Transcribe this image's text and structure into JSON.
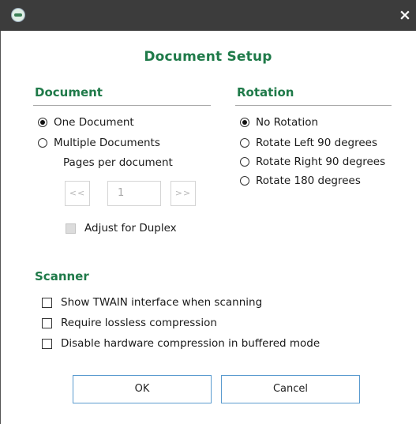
{
  "window": {
    "app_icon": "circle-app-logo",
    "close_label": "×"
  },
  "dialog": {
    "title": "Document Setup"
  },
  "document_group": {
    "header": "Document",
    "options": [
      {
        "label": "One Document",
        "selected": true
      },
      {
        "label": "Multiple Documents",
        "selected": false
      }
    ],
    "pages_per_document_label": "Pages per document",
    "prev_label": "<<",
    "page_value": "1",
    "next_label": ">>",
    "adjust_duplex_label": "Adjust for Duplex"
  },
  "rotation_group": {
    "header": "Rotation",
    "options": [
      {
        "label": "No Rotation",
        "selected": true
      },
      {
        "label": "Rotate Left 90 degrees",
        "selected": false
      },
      {
        "label": "Rotate Right 90 degrees",
        "selected": false
      },
      {
        "label": "Rotate 180 degrees",
        "selected": false
      }
    ]
  },
  "scanner_group": {
    "header": "Scanner",
    "options": [
      {
        "label": "Show TWAIN interface when scanning",
        "checked": false
      },
      {
        "label": "Require lossless compression",
        "checked": false
      },
      {
        "label": "Disable hardware compression in buffered mode",
        "checked": false
      }
    ]
  },
  "buttons": {
    "ok": "OK",
    "cancel": "Cancel"
  },
  "colors": {
    "accent": "#1f7a49",
    "titlebar": "#3c3c3c",
    "button_border": "#5a9bcf"
  }
}
